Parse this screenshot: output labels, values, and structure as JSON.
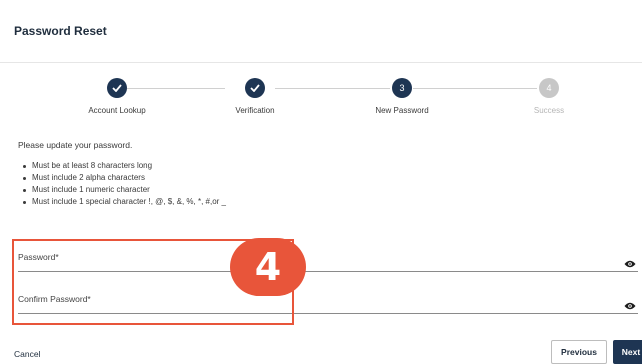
{
  "header": {
    "title": "Password Reset"
  },
  "stepper": {
    "steps": [
      {
        "label": "Account Lookup",
        "status": "complete",
        "number": ""
      },
      {
        "label": "Verification",
        "status": "complete",
        "number": ""
      },
      {
        "label": "New Password",
        "status": "active",
        "number": "3"
      },
      {
        "label": "Success",
        "status": "pending",
        "number": "4"
      }
    ]
  },
  "main": {
    "intro": "Please update your password.",
    "rules": [
      "Must be at least 8 characters long",
      "Must include 2 alpha characters",
      "Must include 1 numeric character",
      "Must include 1 special character !, @, $, &, %, *, #,or _"
    ]
  },
  "form": {
    "password": {
      "placeholder": "Password*",
      "value": ""
    },
    "confirm_password": {
      "placeholder": "Confirm Password*",
      "value": ""
    }
  },
  "annotation": {
    "step_number": "4",
    "color": "#e8553a"
  },
  "footer": {
    "cancel_label": "Cancel",
    "previous_label": "Previous",
    "next_label": "Next"
  },
  "colors": {
    "primary": "#1e3553",
    "pending": "#c7c7c7"
  }
}
